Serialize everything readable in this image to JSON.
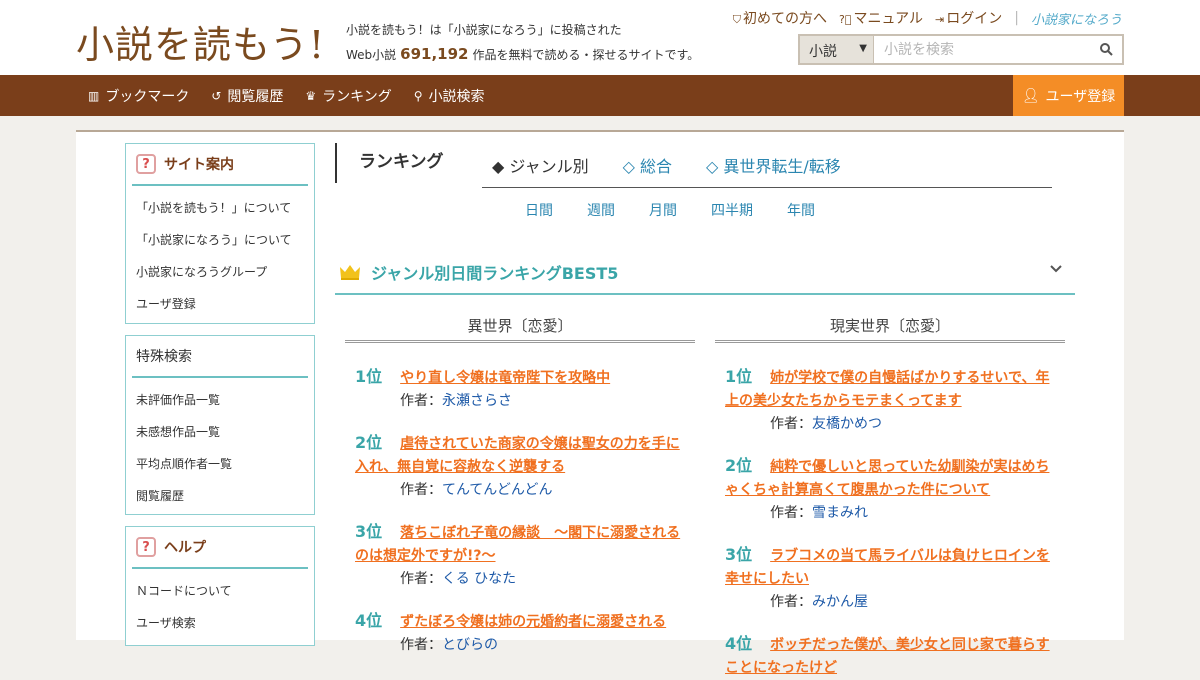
{
  "header": {
    "logo": "小説を読もう!",
    "tagline_line1": "小説を読もう！は「小説家になろう」に投稿された",
    "tagline_prefix": "Web小説",
    "work_count": "691,192",
    "tagline_suffix": "作品を無料で読める・探せるサイトです。",
    "links": [
      "初めての方へ",
      "マニュアル",
      "ログイン"
    ],
    "brand_link": "小説家になろう",
    "search": {
      "select_value": "小説",
      "placeholder": "小説を検索"
    }
  },
  "nav": {
    "items": [
      "ブックマーク",
      "閲覧履歴",
      "ランキング",
      "小説検索"
    ],
    "register": "ユーザ登録"
  },
  "sidebar": {
    "site_guide": {
      "title": "サイト案内",
      "items": [
        "「小説を読もう！」について",
        "「小説家になろう」について",
        "小説家になろうグループ",
        "ユーザ登録"
      ]
    },
    "special_search": {
      "title": "特殊検索",
      "items": [
        "未評価作品一覧",
        "未感想作品一覧",
        "平均点順作者一覧",
        "閲覧履歴"
      ]
    },
    "help": {
      "title": "ヘルプ",
      "items": [
        "Ｎコードについて",
        "ユーザ検索"
      ]
    }
  },
  "main": {
    "title": "ランキング",
    "tabs": [
      "◆ ジャンル別",
      "◇ 総合",
      "◇ 異世界転生/転移"
    ],
    "periods": [
      "日間",
      "週間",
      "月間",
      "四半期",
      "年間"
    ],
    "section_title": "ジャンル別日間ランキングBEST5",
    "author_label": "作者：",
    "columns": [
      {
        "genre": "異世界〔恋愛〕",
        "entries": [
          {
            "rank": "1位",
            "title": "やり直し令嬢は竜帝陛下を攻略中",
            "author": "永瀬さらさ"
          },
          {
            "rank": "2位",
            "title": "虐待されていた商家の令嬢は聖女の力を手に入れ、無自覚に容赦なく逆襲する",
            "author": "てんてんどんどん"
          },
          {
            "rank": "3位",
            "title": "落ちこぼれ子竜の縁談　～閣下に溺愛されるのは想定外ですが!?～",
            "author": "くる ひなた"
          },
          {
            "rank": "4位",
            "title": "ずたぼろ令嬢は姉の元婚約者に溺愛される",
            "author": "とびらの"
          }
        ]
      },
      {
        "genre": "現実世界〔恋愛〕",
        "entries": [
          {
            "rank": "1位",
            "title": "姉が学校で僕の自慢話ばかりするせいで、年上の美少女たちからモテまくってます",
            "author": "友橋かめつ"
          },
          {
            "rank": "2位",
            "title": "純粋で優しいと思っていた幼馴染が実はめちゃくちゃ計算高くて腹黒かった件について",
            "author": "雪まみれ"
          },
          {
            "rank": "3位",
            "title": "ラブコメの当て馬ライバルは負けヒロインを幸せにしたい",
            "author": "みかん屋"
          },
          {
            "rank": "4位",
            "title": "ボッチだった僕が、美少女と同じ家で暮らすことになったけど",
            "author": ""
          }
        ]
      }
    ]
  },
  "colors": {
    "brand_brown": "#7a3e1a",
    "accent_orange": "#f48d26",
    "teal": "#3aa5a8",
    "link_blue": "#2b86b0",
    "title_orange": "#f07020"
  }
}
